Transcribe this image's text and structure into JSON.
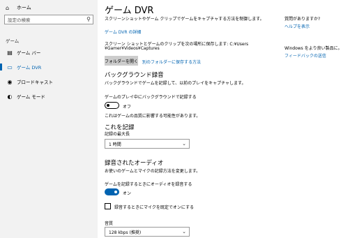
{
  "sidebar": {
    "home_label": "ホーム",
    "search_placeholder": "設定の検索",
    "section_label": "ゲーム",
    "items": [
      {
        "label": "ゲーム バー"
      },
      {
        "label": "ゲーム DVR"
      },
      {
        "label": "ブロードキャスト"
      },
      {
        "label": "ゲーム モード"
      }
    ]
  },
  "main": {
    "title": "ゲーム DVR",
    "intro": "スクリーンショットやゲーム クリップでゲームをキャプチャする方法を制御します。",
    "details_link": "ゲーム DVR の詳細",
    "save_path_line1": "スクリーン ショットとゲームのクリップを次の場所に保存します: C:¥Users",
    "save_path_line2": "¥Gamer¥Videos¥Captures",
    "open_folder_button": "フォルダーを開く",
    "other_folder_link": "別のフォルダーに保存する方法",
    "background": {
      "heading": "バックグラウンド録音",
      "description": "バックグラウンドでゲームを記録して、以前のプレイをキャプチャします。",
      "toggle_label": "ゲームのプレイ中にバックグラウンドで記録する",
      "toggle_state": "オフ",
      "note": "これはゲームの品質に影響する可能性があります。"
    },
    "record_this": {
      "heading": "これを記録",
      "max_length_label": "記録の最大長",
      "max_length_value": "1 時間"
    },
    "audio": {
      "heading": "録音されたオーディオ",
      "description": "お使いのゲームとマイクの記録方法を変更します。",
      "toggle_label": "ゲームを記録するときにオーディオを録音する",
      "toggle_state": "オン",
      "mic_checkbox_label": "録音するときにマイクを既定でオンにする",
      "quality_label": "音質",
      "quality_value": "128 kbps (推奨)"
    }
  },
  "right": {
    "question": "質問がありますか?",
    "help_link": "ヘルプを表示",
    "feedback_text": "Windows をより良い製品に。",
    "feedback_link": "フィードバックの送信"
  },
  "colors": {
    "accent": "#0063b1",
    "sidebar_bg": "#f2f2f2"
  }
}
